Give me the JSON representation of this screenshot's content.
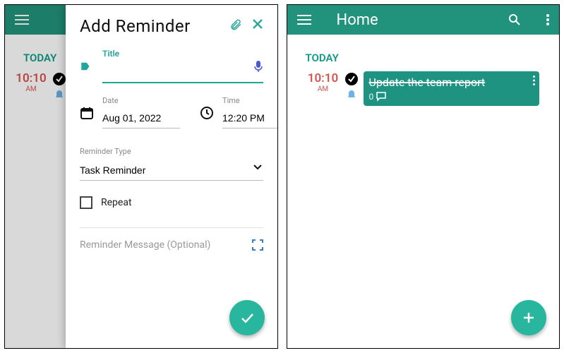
{
  "left": {
    "bg": {
      "today_label": "TODAY",
      "time": "10:10",
      "ampm": "AM"
    },
    "modal": {
      "heading": "Add Reminder",
      "title_label": "Title",
      "title_value": "",
      "date_label": "Date",
      "date_value": "Aug 01, 2022",
      "time_label": "Time",
      "time_value": "12:20 PM",
      "type_label": "Reminder Type",
      "type_value": "Task Reminder",
      "repeat_label": "Repeat",
      "repeat_checked": false,
      "message_placeholder": "Reminder Message (Optional)"
    }
  },
  "right": {
    "header_title": "Home",
    "today_label": "TODAY",
    "time": "10:10",
    "ampm": "AM",
    "task": {
      "title": "Update the team report",
      "comment_count": "0"
    }
  },
  "colors": {
    "brand": "#21937c",
    "fab": "#28b79e",
    "today": "#0f9b86",
    "red": "#d9534f"
  }
}
